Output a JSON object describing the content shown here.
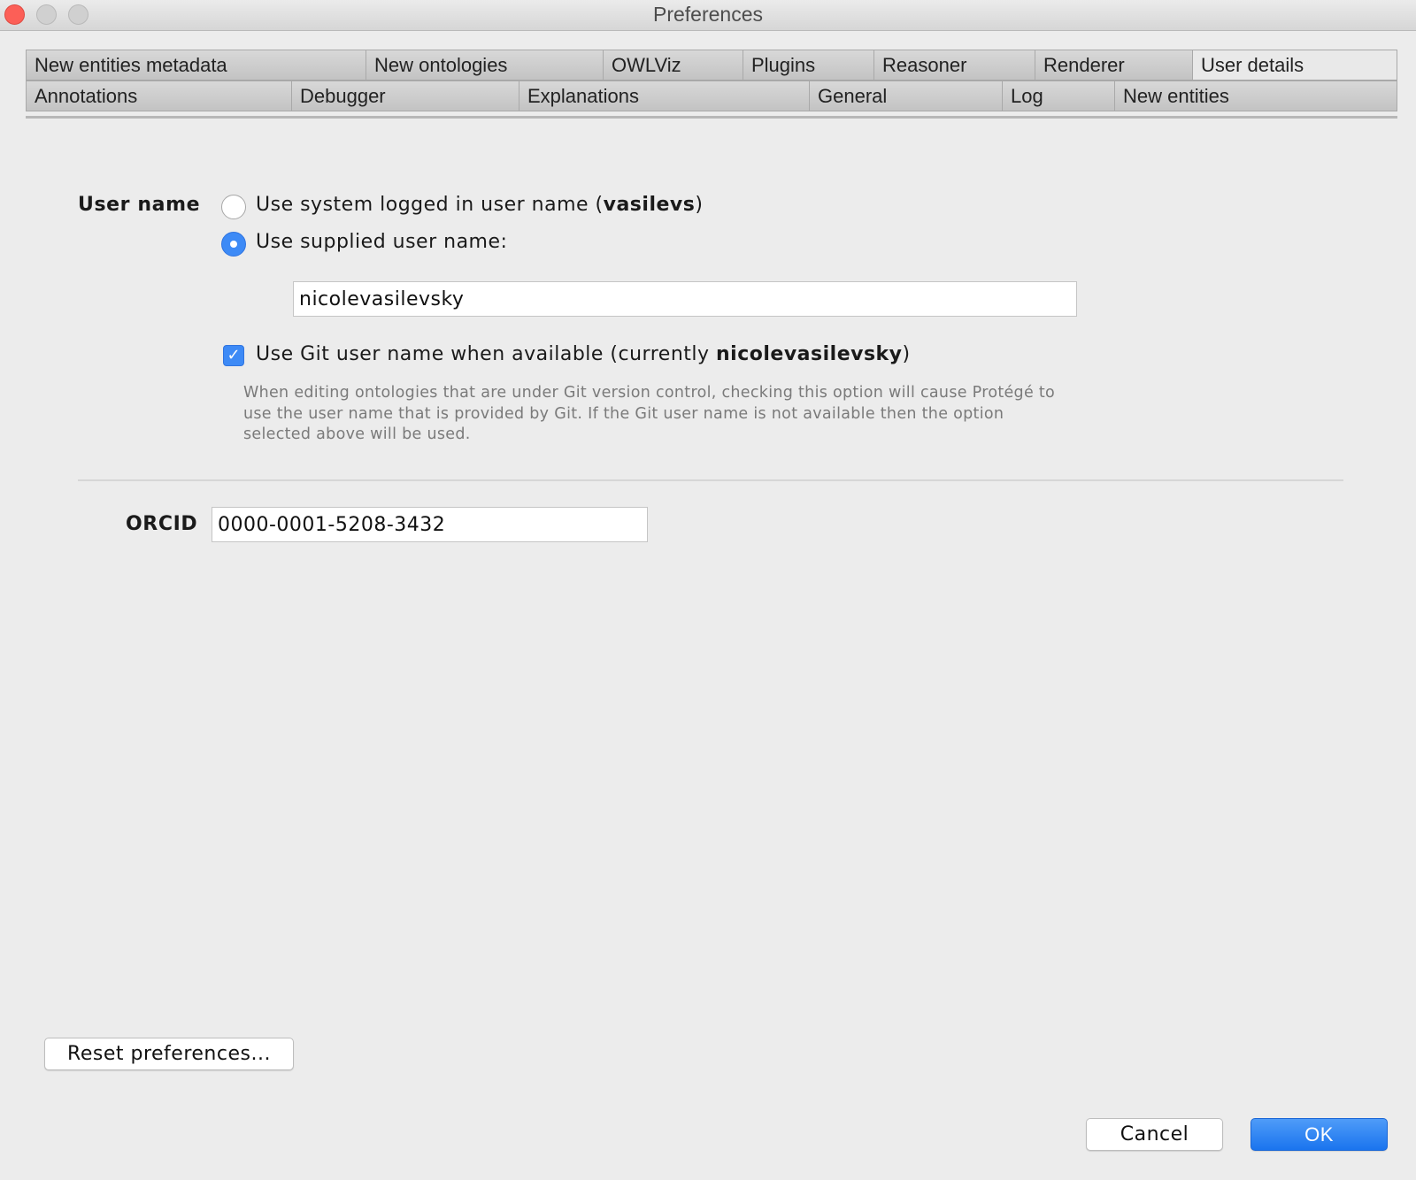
{
  "window": {
    "title": "Preferences"
  },
  "tabs": {
    "row1": [
      "New entities metadata",
      "New ontologies",
      "OWLViz",
      "Plugins",
      "Reasoner",
      "Renderer",
      "User details"
    ],
    "row2": [
      "Annotations",
      "Debugger",
      "Explanations",
      "General",
      "Log",
      "New entities"
    ],
    "selected": "User details"
  },
  "user_name": {
    "label": "User name",
    "system_option": {
      "text": "Use system logged in user name (",
      "username": "vasilevs",
      "suffix": ")",
      "selected": false
    },
    "supplied_option": {
      "text": "Use supplied user name:",
      "selected": true
    },
    "supplied_value": "nicolevasilevsky",
    "git_option": {
      "text": "Use Git user name when available (currently ",
      "username": "nicolevasilevsky",
      "suffix": ")",
      "checked": true
    },
    "help_text": "When editing ontologies that are under Git version control, checking this option will cause Protégé to use the user name that is provided by Git. If the Git user name is not available then the option selected above will be used."
  },
  "orcid": {
    "label": "ORCID",
    "value": "0000-0001-5208-3432"
  },
  "buttons": {
    "reset": "Reset preferences...",
    "cancel": "Cancel",
    "ok": "OK"
  }
}
